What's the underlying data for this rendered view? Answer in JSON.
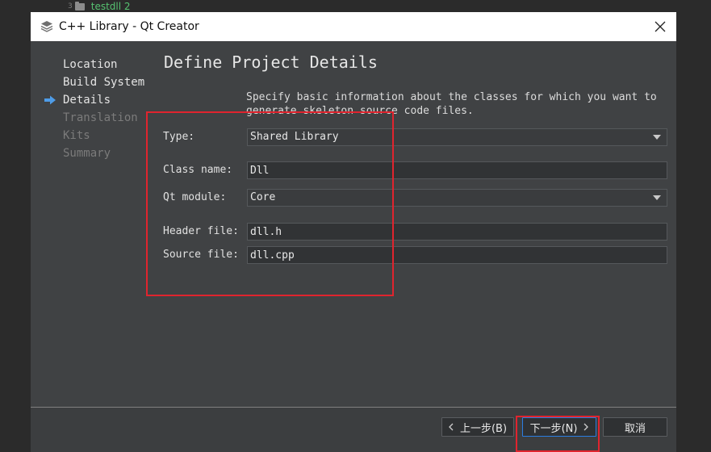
{
  "background": {
    "tree_row_number": "3",
    "tree_project_name": "testdll 2"
  },
  "window": {
    "title": "C++ Library - Qt Creator",
    "app_icon": "qt-creator-layers-icon",
    "close_icon": "close-icon"
  },
  "steps": [
    {
      "label": "Location",
      "state": "done"
    },
    {
      "label": "Build System",
      "state": "done"
    },
    {
      "label": "Details",
      "state": "current"
    },
    {
      "label": "Translation",
      "state": "future"
    },
    {
      "label": "Kits",
      "state": "future"
    },
    {
      "label": "Summary",
      "state": "future"
    }
  ],
  "page": {
    "title": "Define Project Details",
    "description_line1": "Specify basic information about the classes for which you want to",
    "description_line2": "generate skeleton source code files."
  },
  "form": {
    "type_label": "Type:",
    "type_value": "Shared Library",
    "class_label": "Class name:",
    "class_value": "Dll",
    "qt_module_label": "Qt module:",
    "qt_module_value": "Core",
    "header_label": "Header file:",
    "header_value": "dll.h",
    "source_label": "Source file:",
    "source_value": "dll.cpp"
  },
  "buttons": {
    "back_label": "上一步(B)",
    "next_label": "下一步(N)",
    "cancel_label": "取消"
  },
  "colors": {
    "dialog_bg": "#404244",
    "accent_arrow": "#4e9ce8",
    "focus_border": "#2b7de1",
    "annotation_red": "#e0242e"
  }
}
